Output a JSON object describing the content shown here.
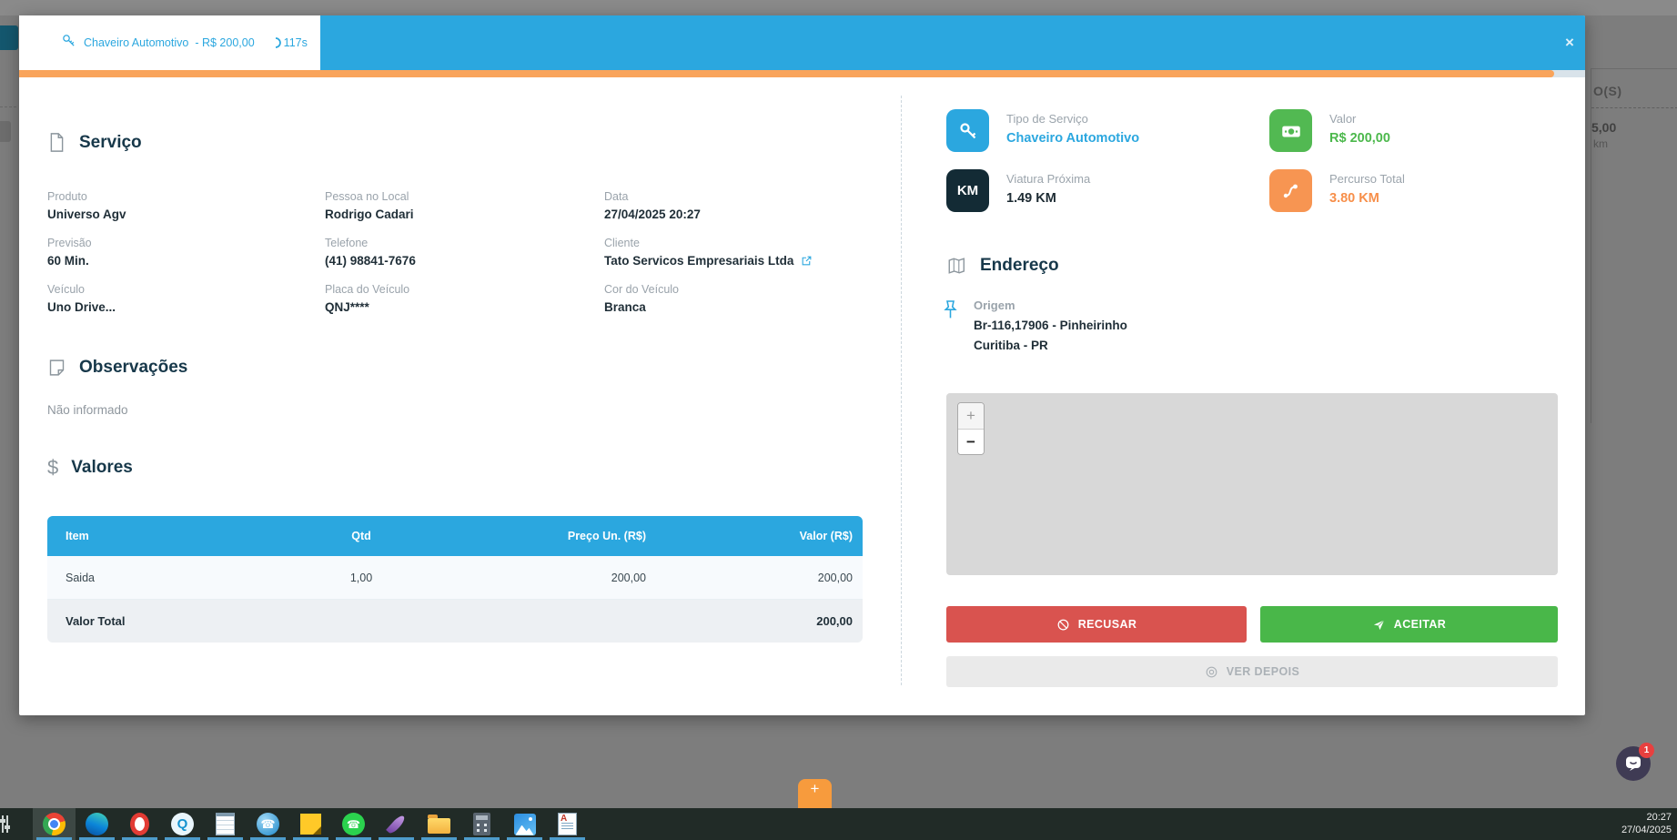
{
  "colors": {
    "accent_blue": "#2ba7df",
    "progress_orange": "#f9a45b",
    "refuse_red": "#d9534f",
    "accept_green": "#49b749",
    "dark_navy": "#17384a",
    "fab_orange": "#f79b3d"
  },
  "backdrop": {
    "right_panel": {
      "line1": "O(S)",
      "line2": "5,00",
      "line3": "km"
    },
    "fab_plus": "+"
  },
  "modal": {
    "header": {
      "title": "Chaveiro Automotivo",
      "price_text": "- R$ 200,00",
      "timer": "117s",
      "close_label": "×"
    },
    "service": {
      "title": "Serviço",
      "fields": [
        {
          "label": "Produto",
          "value": "Universo Agv"
        },
        {
          "label": "Pessoa no Local",
          "value": "Rodrigo Cadari"
        },
        {
          "label": "Data",
          "value": "27/04/2025 20:27"
        },
        {
          "label": "Previsão",
          "value": "60 Min."
        },
        {
          "label": "Telefone",
          "value": "(41) 98841-7676"
        },
        {
          "label": "Cliente",
          "value": "Tato Servicos Empresariais Ltda"
        },
        {
          "label": "Veículo",
          "value": "Uno Drive..."
        },
        {
          "label": "Placa do Veículo",
          "value": "QNJ****"
        },
        {
          "label": "Cor do Veículo",
          "value": "Branca"
        }
      ]
    },
    "observations": {
      "title": "Observações",
      "value": "Não informado"
    },
    "valores": {
      "title": "Valores",
      "table": {
        "headers": [
          "Item",
          "Qtd",
          "Preço Un. (R$)",
          "Valor (R$)"
        ],
        "row": [
          "Saida",
          "1,00",
          "200,00",
          "200,00"
        ],
        "total_label": "Valor Total",
        "total_value": "200,00"
      }
    },
    "summary_cards": [
      {
        "label": "Tipo de Serviço",
        "value": "Chaveiro Automotivo",
        "icon": "key-icon"
      },
      {
        "label": "Valor",
        "value": "R$ 200,00",
        "icon": "money-icon"
      },
      {
        "label": "Viatura Próxima",
        "value": "1.49 KM",
        "icon": "km-icon",
        "icon_text": "KM"
      },
      {
        "label": "Percurso Total",
        "value": "3.80 KM",
        "icon": "route-icon"
      }
    ],
    "address": {
      "title": "Endereço",
      "origin_label": "Origem",
      "origin_line1": "Br-116,17906 - Pinheirinho",
      "origin_line2": "Curitiba - PR"
    },
    "map": {
      "zoom_in": "+",
      "zoom_out": "−"
    },
    "actions": {
      "refuse": "RECUSAR",
      "accept": "ACEITAR",
      "later": "VER DEPOIS"
    }
  },
  "chat_widget": {
    "badge": "1"
  },
  "taskbar": {
    "icons": [
      "volume-slider",
      "chrome",
      "edge",
      "opera",
      "q-app",
      "notepad",
      "phone-dialer",
      "sticky-notes",
      "whatsapp",
      "feather-app",
      "file-explorer",
      "calculator",
      "photos",
      "wordpad"
    ],
    "q_glyph": "Q",
    "wordpad_glyph": "A",
    "clock_time": "20:27",
    "clock_date": "27/04/2025"
  }
}
